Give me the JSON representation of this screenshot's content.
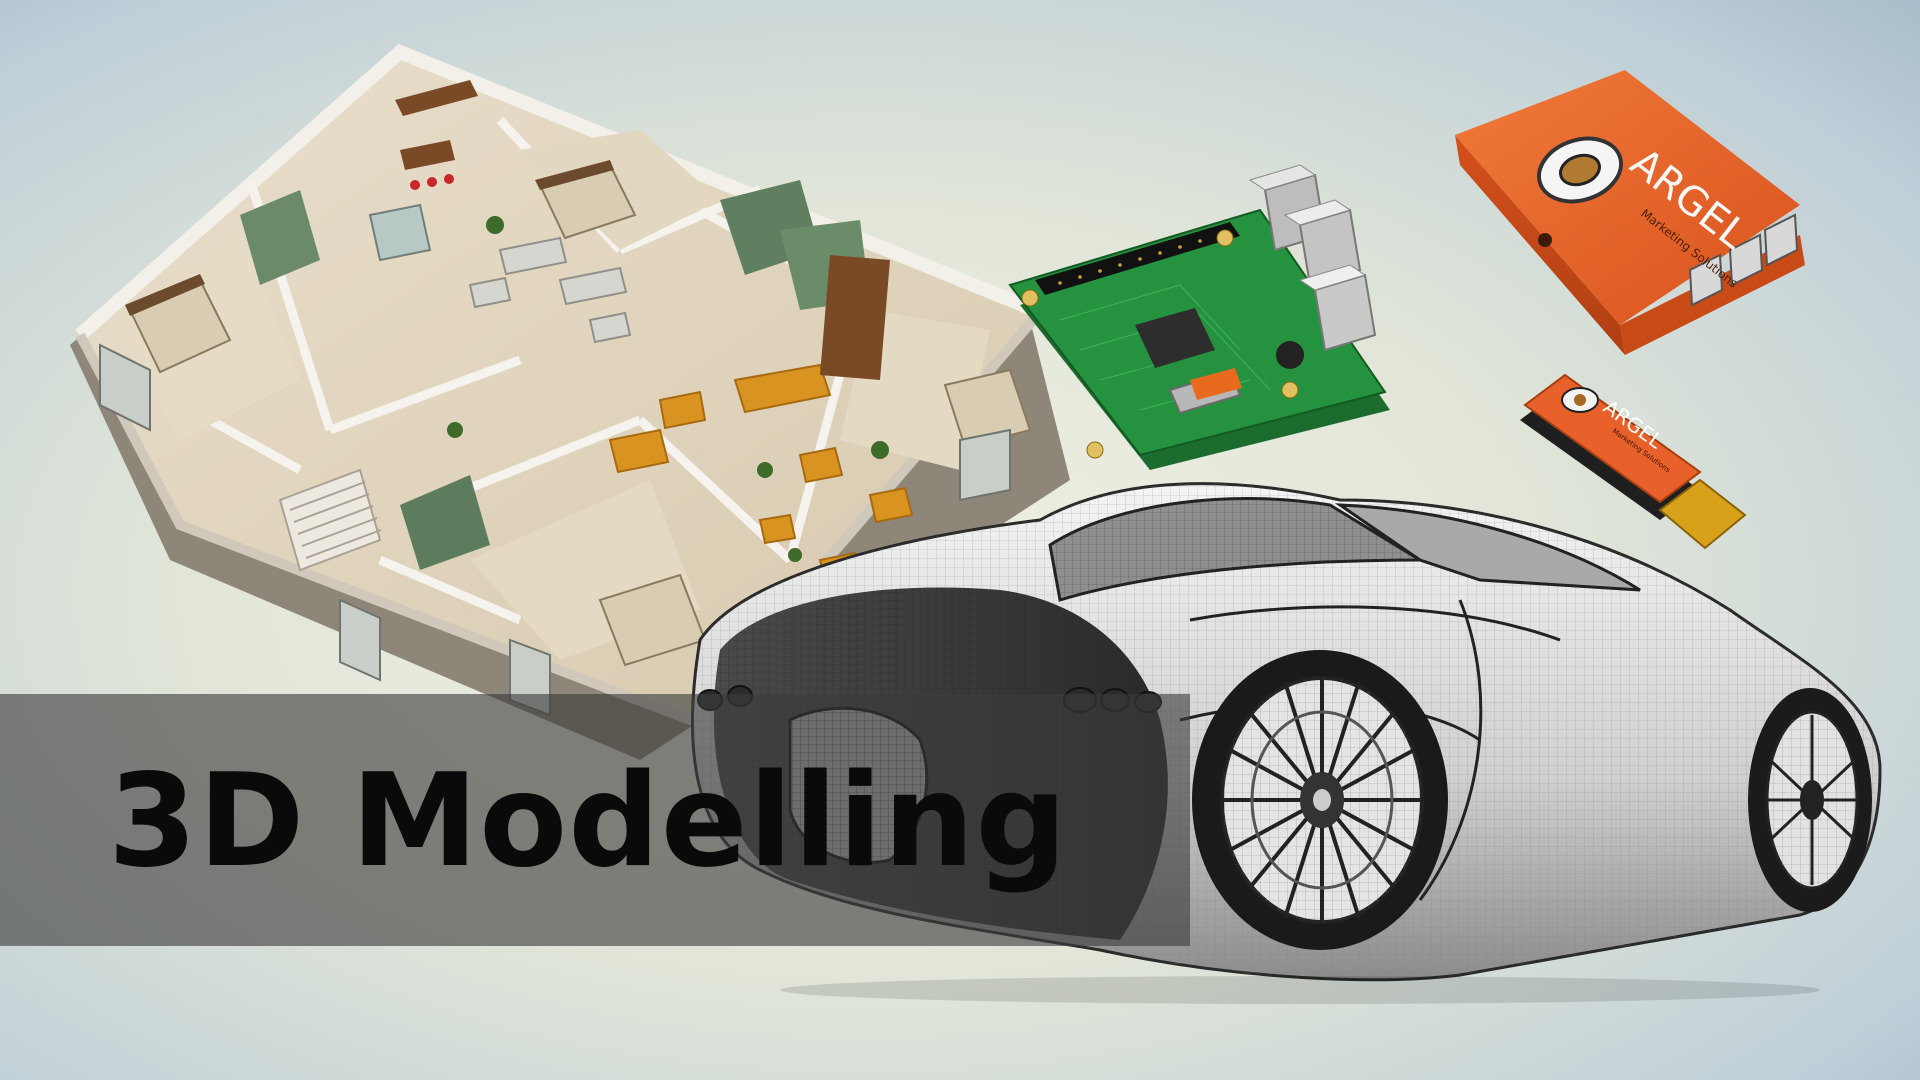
{
  "title": "3D Modelling",
  "case_brand": {
    "name": "ARGEL",
    "tagline": "Marketing Solutions"
  },
  "dongle_brand": {
    "name": "ARGEL",
    "tagline": "Marketing Solutions"
  },
  "colors": {
    "brand_orange": "#e8602a",
    "pcb_green": "#1f8a3a",
    "banner": "#3c3c3c"
  }
}
